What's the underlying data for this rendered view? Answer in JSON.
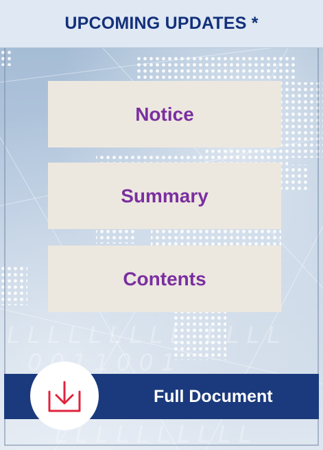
{
  "header": {
    "title": "UPCOMING UPDATES *"
  },
  "buttons": [
    {
      "label": "Notice"
    },
    {
      "label": "Summary"
    },
    {
      "label": "Contents"
    }
  ],
  "download": {
    "label": "Full Document",
    "icon": "download-tray-icon"
  },
  "colors": {
    "header_text": "#13307a",
    "button_text": "#7a2fa0",
    "button_bg": "#ede8df",
    "bar_bg": "#1b3a7d",
    "icon_accent": "#e0233c"
  }
}
